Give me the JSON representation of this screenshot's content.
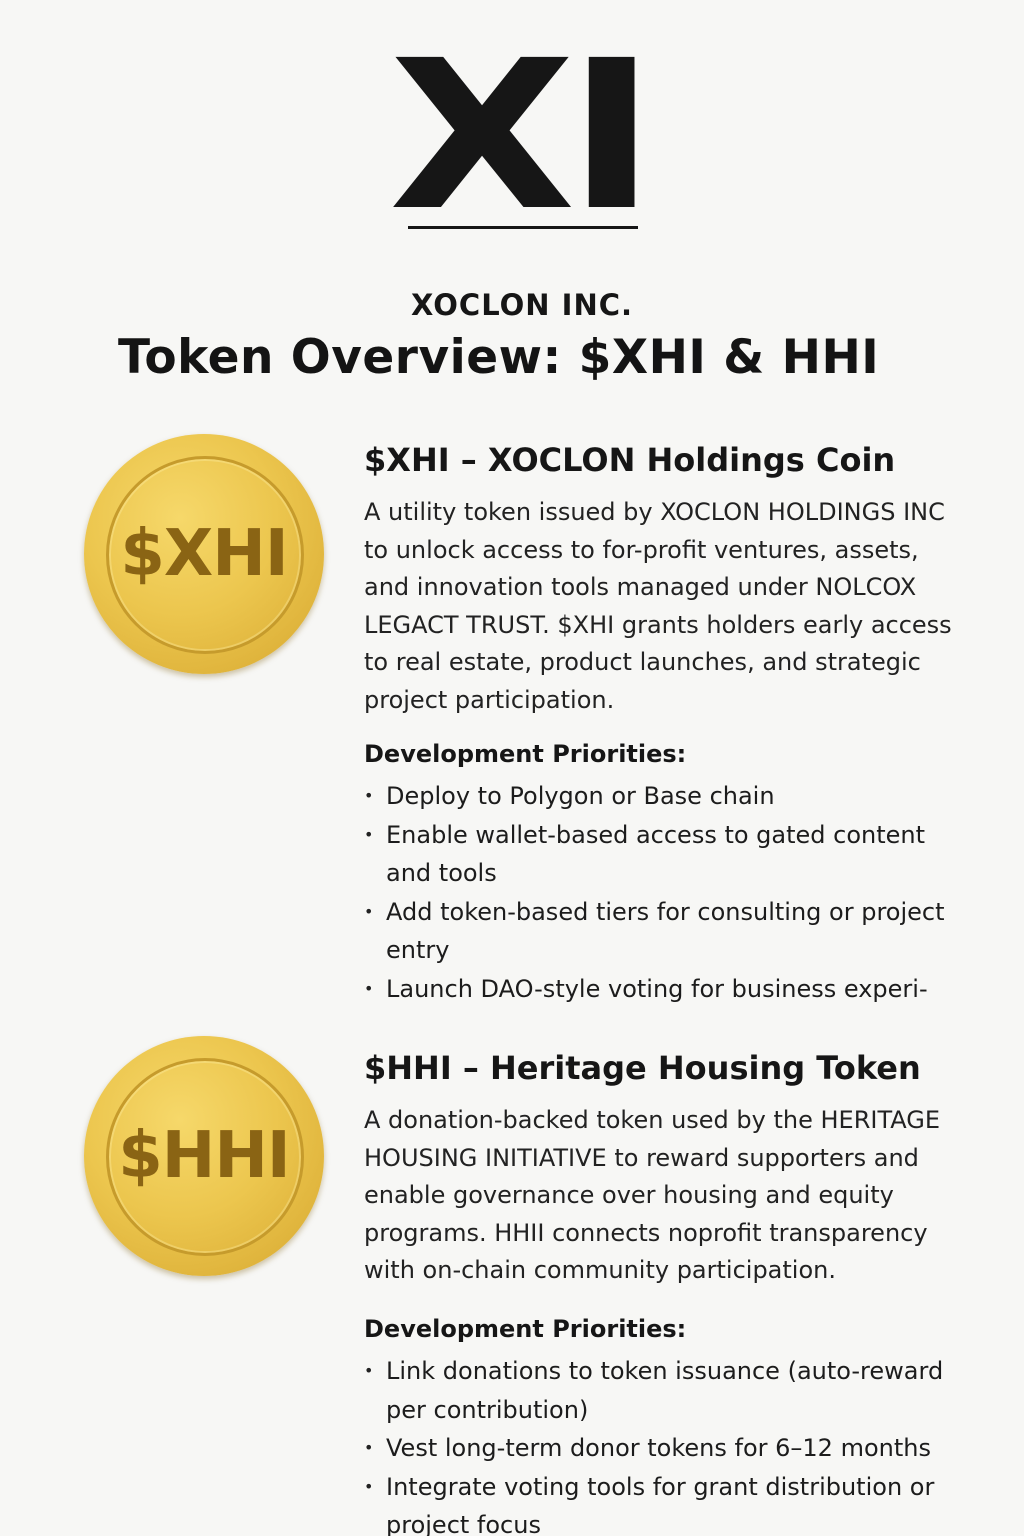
{
  "logo": {
    "mark": "XI",
    "company": "XOCLON INC."
  },
  "title": "Token Overview: $XHI & HHI",
  "tokens": [
    {
      "coin_label": "$XHI",
      "heading": "$XHI – XOCLON Holdings Coin",
      "description": "A utility token issued by XOCLON HOLDINGS INC to unlock access to for-profit ventures, assets, and innovation tools managed under NOLCOX LEGACT TRUST. $XHI grants holders early access to real estate, product launches, and strategic project participation.",
      "priorities_heading": "Development Priorities:",
      "priorities": [
        "Deploy to Polygon or Base chain",
        "Enable wallet-based access to gated content and tools",
        "Add token-based tiers for consulting or project entry",
        "Launch DAO-style voting for business experi-"
      ]
    },
    {
      "coin_label": "$HHI",
      "heading": "$HHI – Heritage Housing Token",
      "description": "A donation-backed token used by the HERITAGE HOUSING INITIATIVE to reward supporters and enable governance over housing and equity programs. HHII connects noprofit transparency with on-chain community participation.",
      "priorities_heading": "Development Priorities:",
      "priorities": [
        "Link donations to token issuance (auto-reward per contribution)",
        "Vest long-term donor tokens for 6–12 months",
        "Integrate voting tools for grant distribution or project focus"
      ]
    }
  ],
  "colors": {
    "background": "#f7f7f5",
    "text": "#161616",
    "coin_gold": "#ecc64e",
    "coin_text": "#8a6414"
  }
}
